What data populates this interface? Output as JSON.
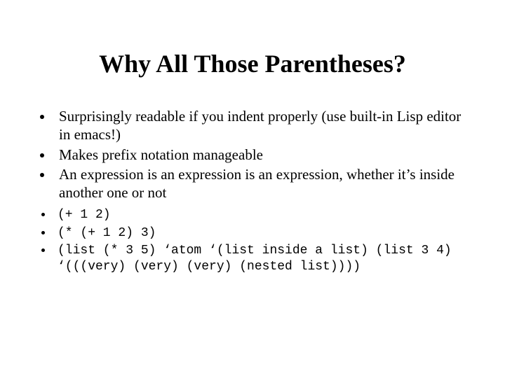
{
  "slide": {
    "title": "Why All Those Parentheses?",
    "points": [
      "Surprisingly readable if you indent properly (use built-in Lisp editor in emacs!)",
      "Makes prefix notation manageable",
      "An expression is an expression is an expression, whether it’s inside another one or not"
    ],
    "code": [
      "(+ 1 2)",
      "(* (+ 1 2) 3)",
      "(list (* 3 5) ‘atom ‘(list inside a list) (list 3 4) ‘(((very) (very) (very) (nested list))))"
    ]
  }
}
